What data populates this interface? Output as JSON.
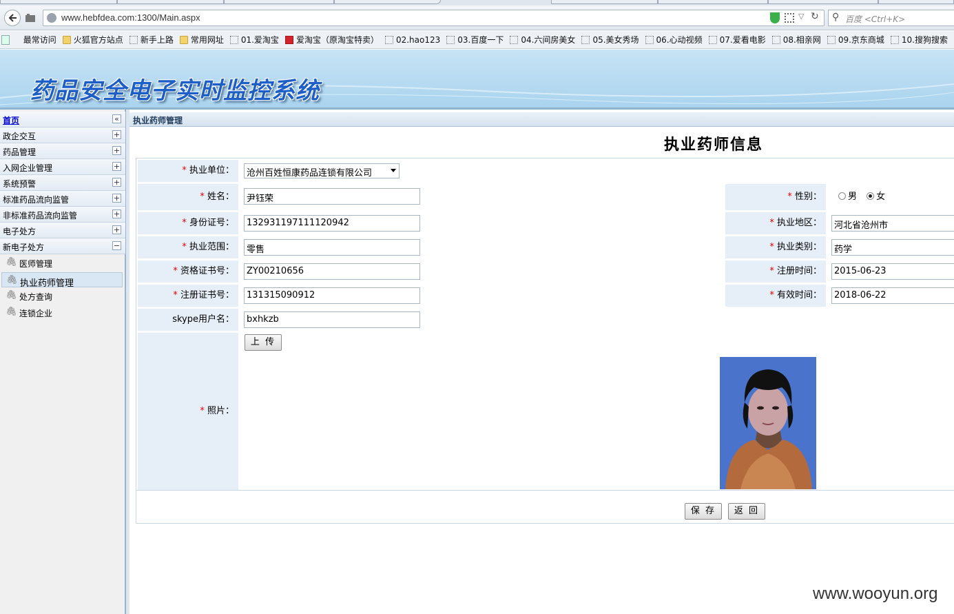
{
  "browser": {
    "url": "www.hebfdea.com:1300/Main.aspx",
    "search_placeholder": "百度 <Ctrl+K>"
  },
  "bookmarks": [
    {
      "label": "最常访问",
      "icon": "star"
    },
    {
      "label": "火狐官方站点",
      "icon": "folder"
    },
    {
      "label": "新手上路",
      "icon": "page"
    },
    {
      "label": "常用网址",
      "icon": "folder"
    },
    {
      "label": "01.爱淘宝",
      "icon": "page"
    },
    {
      "label": "爱淘宝（原淘宝特卖）",
      "icon": "red"
    },
    {
      "label": "02.hao123",
      "icon": "page"
    },
    {
      "label": "03.百度一下",
      "icon": "page"
    },
    {
      "label": "04.六间房美女",
      "icon": "page"
    },
    {
      "label": "05.美女秀场",
      "icon": "page"
    },
    {
      "label": "06.心动视频",
      "icon": "page"
    },
    {
      "label": "07.爱看电影",
      "icon": "page"
    },
    {
      "label": "08.相亲网",
      "icon": "page"
    },
    {
      "label": "09.京东商城",
      "icon": "page"
    },
    {
      "label": "10.搜狗搜索",
      "icon": "page"
    }
  ],
  "banner": {
    "title": "药品安全电子实时监控系统"
  },
  "sidebar": {
    "home": "首页",
    "collapse_glyph": "«",
    "sections": [
      {
        "label": "政企交互",
        "toggle": "+"
      },
      {
        "label": "药品管理",
        "toggle": "+"
      },
      {
        "label": "入网企业管理",
        "toggle": "+"
      },
      {
        "label": "系统预警",
        "toggle": "+"
      },
      {
        "label": "标准药品流向监管",
        "toggle": "+"
      },
      {
        "label": "非标准药品流向监管",
        "toggle": "+"
      },
      {
        "label": "电子处方",
        "toggle": "+"
      },
      {
        "label": "新电子处方",
        "toggle": "−"
      }
    ],
    "subitems": [
      {
        "label": "医师管理"
      },
      {
        "label": "执业药师管理"
      },
      {
        "label": "处方查询"
      },
      {
        "label": "连锁企业"
      }
    ]
  },
  "main": {
    "breadcrumb": "执业药师管理",
    "title": "执业药师信息",
    "req": "*",
    "fields": {
      "unit": {
        "label": "执业单位：",
        "value": "沧州百姓恒康药品连锁有限公司"
      },
      "name": {
        "label": "姓名：",
        "value": "尹钰荣"
      },
      "gender": {
        "label": "性别：",
        "male": "男",
        "female": "女",
        "selected": "女"
      },
      "idno": {
        "label": "身份证号：",
        "value": "132931197111120942"
      },
      "region": {
        "label": "执业地区：",
        "value": "河北省沧州市"
      },
      "scope": {
        "label": "执业范围：",
        "value": "零售"
      },
      "category": {
        "label": "执业类别：",
        "value": "药学"
      },
      "qualno": {
        "label": "资格证书号：",
        "value": "ZY00210656"
      },
      "regdate": {
        "label": "注册时间：",
        "value": "2015-06-23"
      },
      "regno": {
        "label": "注册证书号：",
        "value": "131315090912"
      },
      "validdate": {
        "label": "有效时间：",
        "value": "2018-06-22"
      },
      "skype": {
        "label": "skype用户名：",
        "value": "bxhkzb"
      },
      "photo": {
        "label": "照片：",
        "upload": "上 传"
      }
    },
    "buttons": {
      "save": "保 存",
      "back": "返 回"
    }
  },
  "watermark": "www.wooyun.org"
}
